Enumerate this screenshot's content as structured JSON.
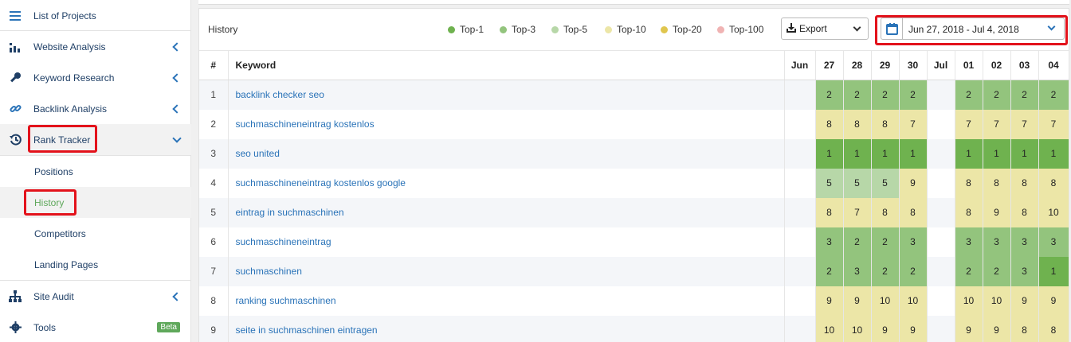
{
  "sidebar": {
    "project_list": "List of Projects",
    "website_analysis": "Website Analysis",
    "keyword_research": "Keyword Research",
    "backlink_analysis": "Backlink Analysis",
    "rank_tracker": "Rank Tracker",
    "positions": "Positions",
    "history": "History",
    "competitors": "Competitors",
    "landing_pages": "Landing Pages",
    "site_audit": "Site Audit",
    "tools": "Tools",
    "tools_badge": "Beta"
  },
  "panel": {
    "title": "History",
    "legend": [
      {
        "label": "Top-1",
        "color": "#6fb24f"
      },
      {
        "label": "Top-3",
        "color": "#93c47d"
      },
      {
        "label": "Top-5",
        "color": "#b7d7a8"
      },
      {
        "label": "Top-10",
        "color": "#ece6a7"
      },
      {
        "label": "Top-20",
        "color": "#e0c64e"
      },
      {
        "label": "Top-100",
        "color": "#f0b3b3"
      }
    ],
    "export_label": "Export",
    "date_range": "Jun 27, 2018 - Jul 4, 2018"
  },
  "table": {
    "headers": {
      "num": "#",
      "keyword": "Keyword",
      "jun": "Jun",
      "jul": "Jul"
    },
    "days": [
      "27",
      "28",
      "29",
      "30",
      "01",
      "02",
      "03",
      "04"
    ],
    "rows": [
      {
        "n": "1",
        "keyword": "backlink checker seo",
        "values": [
          "2",
          "2",
          "2",
          "2",
          "2",
          "2",
          "2",
          "2"
        ]
      },
      {
        "n": "2",
        "keyword": "suchmaschineneintrag kostenlos",
        "values": [
          "8",
          "8",
          "8",
          "7",
          "7",
          "7",
          "7",
          "7"
        ]
      },
      {
        "n": "3",
        "keyword": "seo united",
        "values": [
          "1",
          "1",
          "1",
          "1",
          "1",
          "1",
          "1",
          "1"
        ]
      },
      {
        "n": "4",
        "keyword": "suchmaschineneintrag kostenlos google",
        "values": [
          "5",
          "5",
          "5",
          "9",
          "8",
          "8",
          "8",
          "8"
        ]
      },
      {
        "n": "5",
        "keyword": "eintrag in suchmaschinen",
        "values": [
          "8",
          "7",
          "8",
          "8",
          "8",
          "9",
          "8",
          "10"
        ]
      },
      {
        "n": "6",
        "keyword": "suchmaschineneintrag",
        "values": [
          "3",
          "2",
          "2",
          "3",
          "3",
          "3",
          "3",
          "3"
        ]
      },
      {
        "n": "7",
        "keyword": "suchmaschinen",
        "values": [
          "2",
          "3",
          "2",
          "2",
          "2",
          "2",
          "3",
          "1"
        ]
      },
      {
        "n": "8",
        "keyword": "ranking suchmaschinen",
        "values": [
          "9",
          "9",
          "10",
          "10",
          "10",
          "10",
          "9",
          "9"
        ]
      },
      {
        "n": "9",
        "keyword": "seite in suchmaschinen eintragen",
        "values": [
          "10",
          "10",
          "9",
          "9",
          "9",
          "9",
          "8",
          "8"
        ]
      }
    ]
  }
}
